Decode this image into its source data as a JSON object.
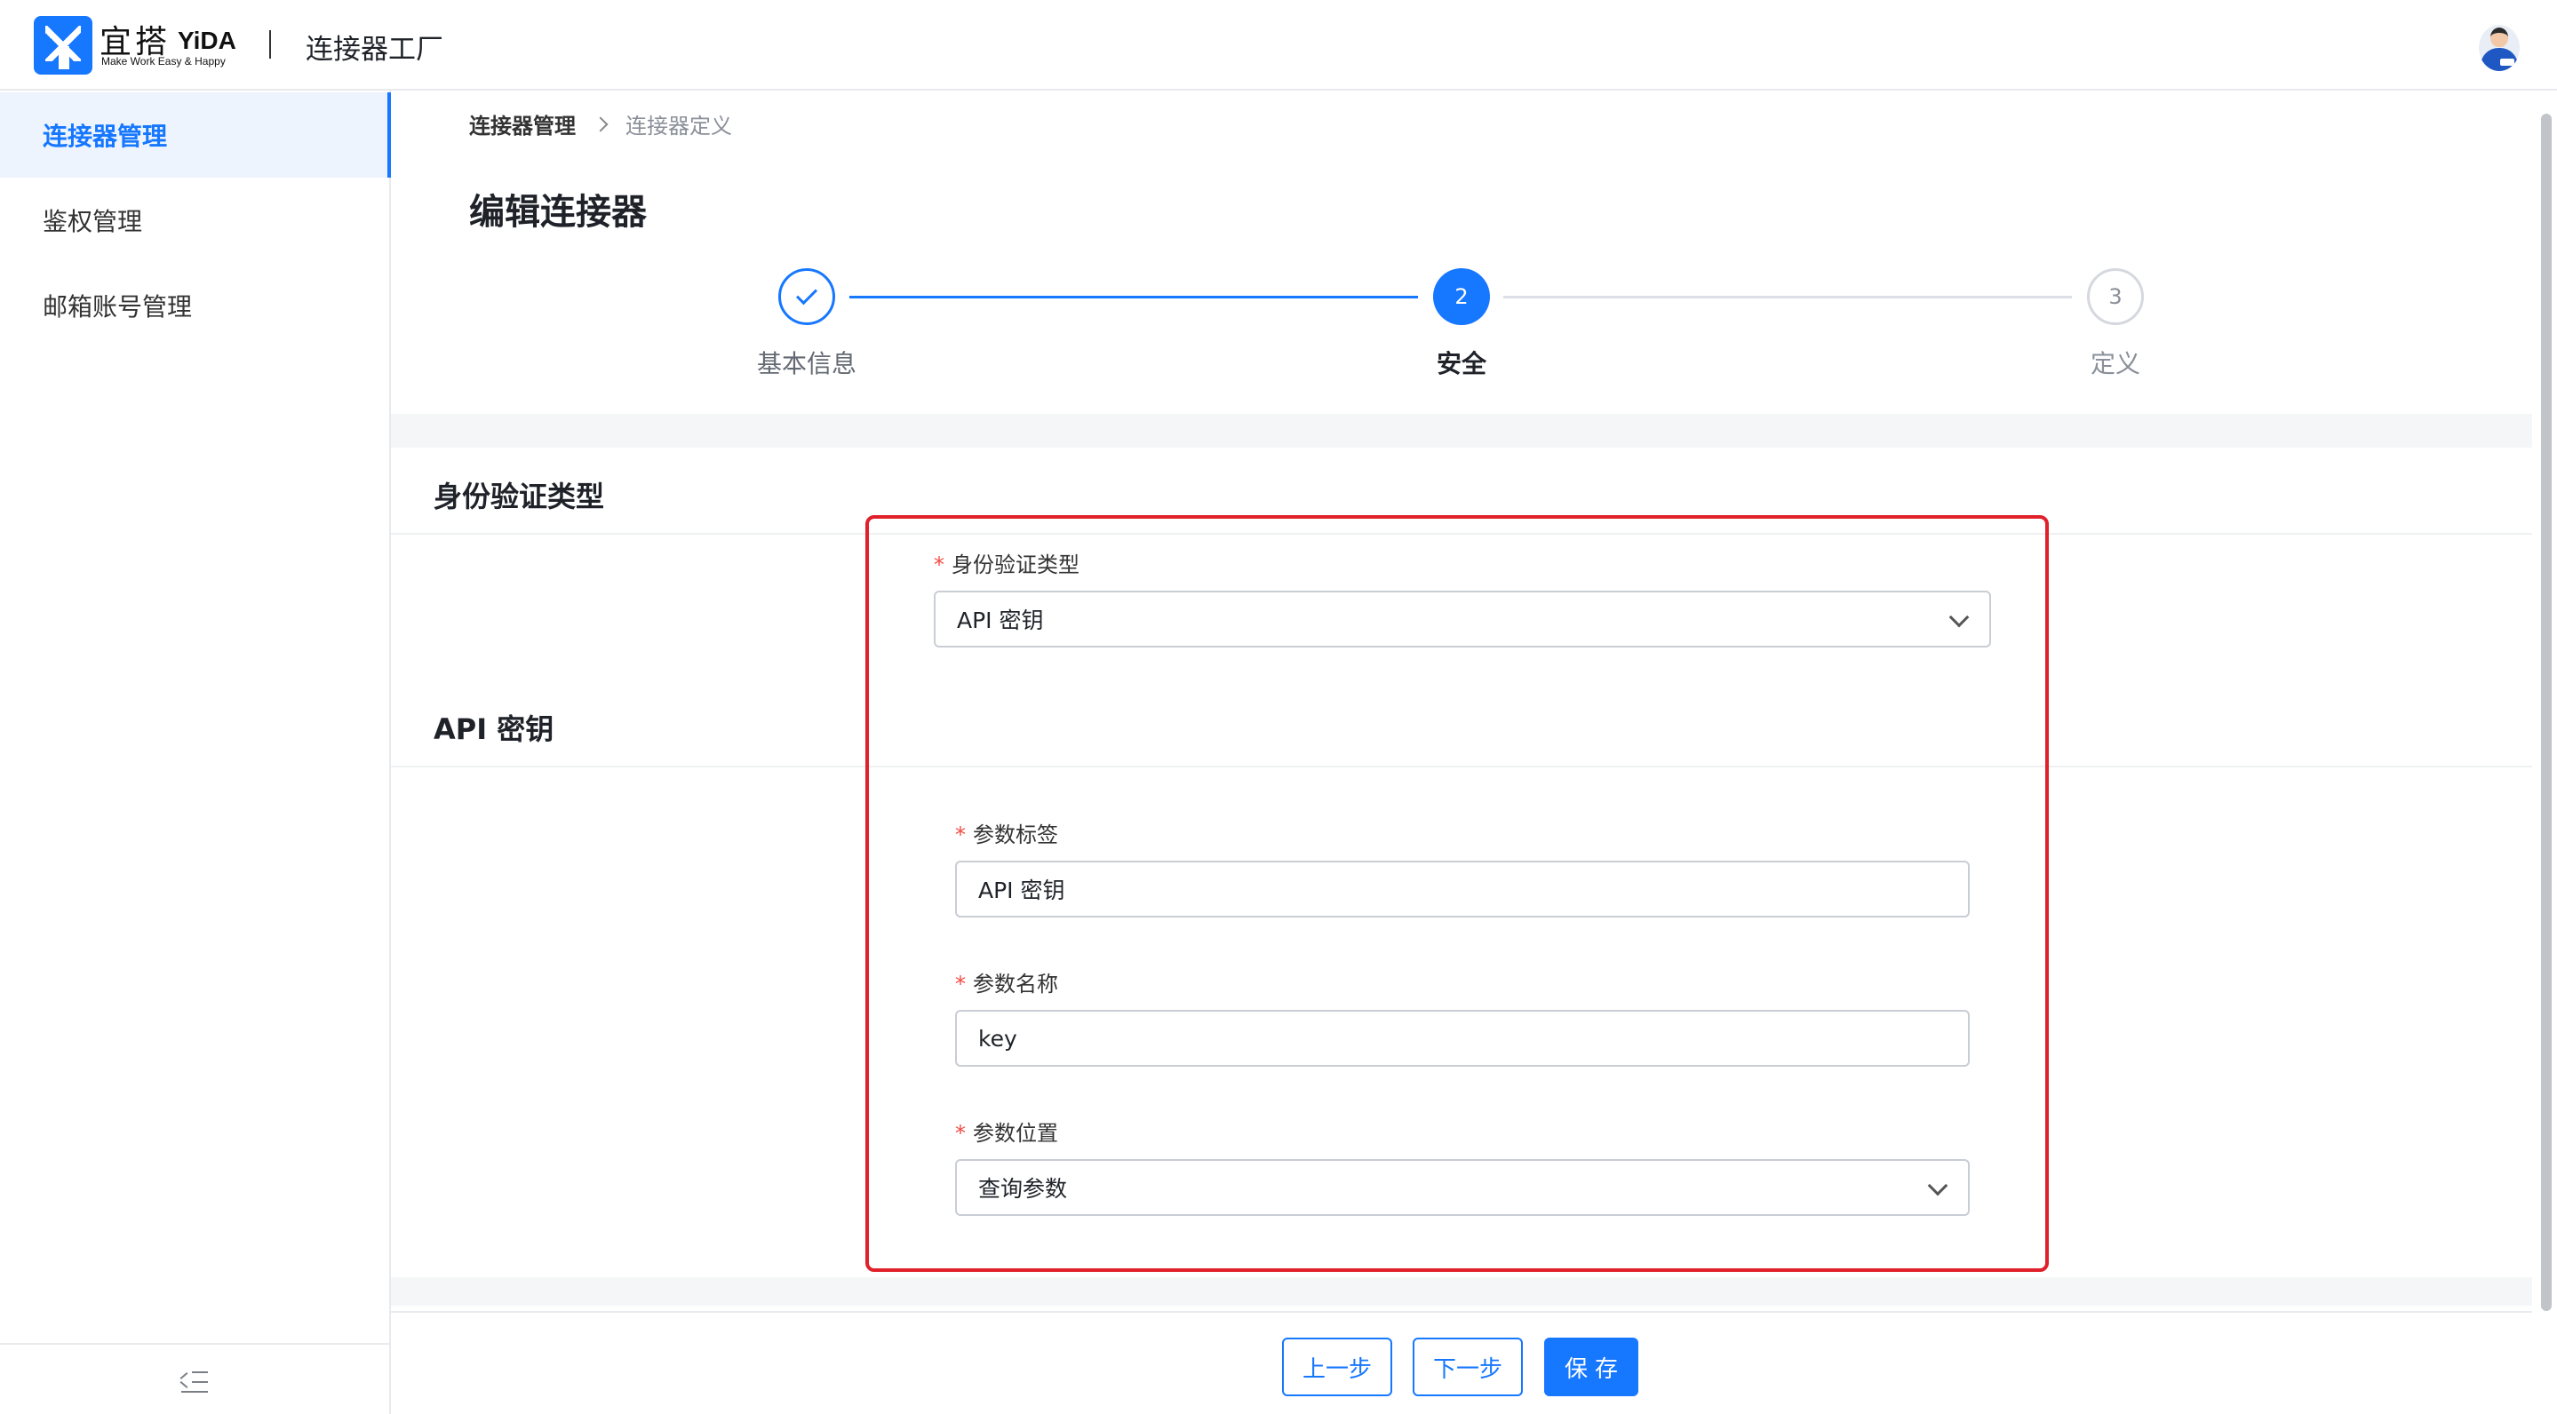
{
  "header": {
    "logo_cn": "宜搭",
    "logo_en": "YiDA",
    "logo_slogan": "Make Work Easy & Happy",
    "app_title": "连接器工厂"
  },
  "sidebar": {
    "items": [
      {
        "label": "连接器管理",
        "active": true
      },
      {
        "label": "鉴权管理",
        "active": false
      },
      {
        "label": "邮箱账号管理",
        "active": false
      }
    ]
  },
  "breadcrumb": [
    "连接器管理",
    "连接器定义"
  ],
  "page_title": "编辑连接器",
  "steps": [
    {
      "label": "基本信息",
      "index": "",
      "status": "done"
    },
    {
      "label": "安全",
      "index": "2",
      "status": "current"
    },
    {
      "label": "定义",
      "index": "3",
      "status": "todo"
    }
  ],
  "auth_section": {
    "title": "身份验证类型",
    "field_label": "身份验证类型",
    "value": "API 密钥"
  },
  "api_key_section": {
    "title": "API 密钥",
    "param_label": {
      "label": "参数标签",
      "value": "API 密钥"
    },
    "param_name": {
      "label": "参数名称",
      "value": "key"
    },
    "param_location": {
      "label": "参数位置",
      "value": "查询参数"
    }
  },
  "required_mark": "*",
  "footer": {
    "prev": "上一步",
    "next": "下一步",
    "save": "保存"
  },
  "colors": {
    "primary": "#1677ff",
    "highlight": "#e0202a",
    "required": "#f54a45"
  }
}
